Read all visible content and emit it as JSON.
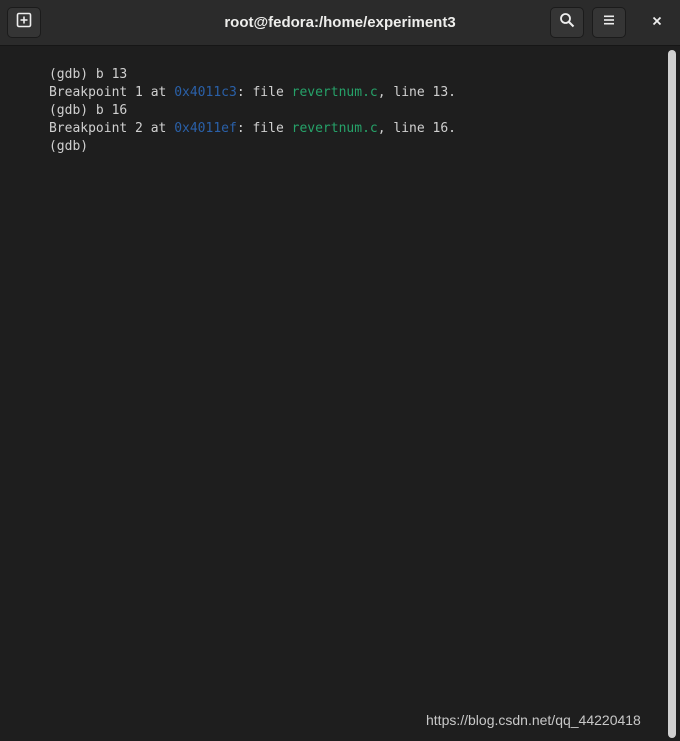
{
  "window": {
    "title": "root@fedora:/home/experiment3"
  },
  "headerbar": {
    "new_tab_icon": "new-tab-icon",
    "search_icon": "search-icon",
    "menu_icon": "hamburger-menu-icon",
    "close_icon": "close-icon"
  },
  "terminal": {
    "lines": [
      {
        "text": "(gdb) b 13"
      },
      {
        "prefix": "Breakpoint 1 at ",
        "address": "0x4011c3",
        "middle": ": file ",
        "filename": "revertnum.c",
        "suffix": ", line 13."
      },
      {
        "text": "(gdb) b 16"
      },
      {
        "prefix": "Breakpoint 2 at ",
        "address": "0x4011ef",
        "middle": ": file ",
        "filename": "revertnum.c",
        "suffix": ", line 16."
      },
      {
        "text": "(gdb) "
      }
    ],
    "colors": {
      "background": "#1e1e1e",
      "foreground": "#d0d0d0",
      "address": "#2a60a8",
      "filename": "#26a269"
    }
  },
  "watermark": {
    "text": "https://blog.csdn.net/qq_44220418"
  }
}
